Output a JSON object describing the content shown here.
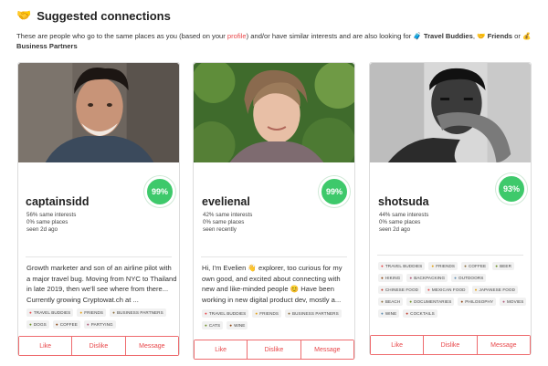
{
  "header": {
    "title": "Suggested connections",
    "desc_pre": "These are people who go to the same places as you (based on your ",
    "desc_link": "profile",
    "desc_mid": ") and/or have similar interests and are also looking for ",
    "desc_travel": "Travel Buddies",
    "desc_comma": ", ",
    "desc_friends": "Friends",
    "desc_or": " or ",
    "desc_business": "Business Partners"
  },
  "buttons": {
    "like": "Like",
    "dislike": "Dislike",
    "message": "Message"
  },
  "cards": [
    {
      "name": "captainsidd",
      "match": "99%",
      "interests": "56% same interests",
      "places": "0% same places",
      "seen": "seen 2d ago",
      "bio_1": "Growth marketer and son of an airline pilot with",
      "bio_2": "a major travel bug. Moving from NYC to Thailand",
      "bio_3": "in late 2019, then we'll see where from there...",
      "bio_4": "Currently growing Cryptowat.ch at ...",
      "tags": [
        "TRAVEL BUDDIES",
        "FRIENDS",
        "BUSINESS PARTNERS",
        "DOGS",
        "COFFEE",
        "PARTYING"
      ]
    },
    {
      "name": "evelienal",
      "match": "99%",
      "interests": "42% same interests",
      "places": "0% same places",
      "seen": "seen recently",
      "bio_1": "Hi, I'm Evelien 👋  explorer, too curious for my",
      "bio_2": "own good, and excited about connecting with",
      "bio_3": "new and like-minded people 😊  Have been",
      "bio_4": "working in new digital product dev, mostly a...",
      "tags": [
        "TRAVEL BUDDIES",
        "FRIENDS",
        "BUSINESS PARTNERS",
        "CATS",
        "WINE"
      ]
    },
    {
      "name": "shotsuda",
      "match": "93%",
      "interests": "44% same interests",
      "places": "0% same places",
      "seen": "seen 2d ago",
      "tags": [
        "TRAVEL BUDDIES",
        "FRIENDS",
        "COFFEE",
        "BEER",
        "HIKING",
        "BACKPACKING",
        "OUTDOORS",
        "CHINESE FOOD",
        "MEXICAN FOOD",
        "JAPANESE FOOD",
        "BEACH",
        "DOCUMENTARIES",
        "PHILOSOPHY",
        "MOVIES",
        "WINE",
        "COCKTAILS"
      ]
    }
  ],
  "tag_icons": {
    "TRAVEL BUDDIES": "●",
    "FRIENDS": "●",
    "BUSINESS PARTNERS": "●",
    "DOGS": "●",
    "COFFEE": "●",
    "PARTYING": "●",
    "CATS": "●",
    "WINE": "●",
    "BEER": "●",
    "HIKING": "●",
    "BACKPACKING": "●",
    "OUTDOORS": "●",
    "CHINESE FOOD": "●",
    "MEXICAN FOOD": "●",
    "JAPANESE FOOD": "●",
    "BEACH": "●",
    "DOCUMENTARIES": "●",
    "PHILOSOPHY": "●",
    "MOVIES": "●",
    "COCKTAILS": "●"
  },
  "colors": {
    "accent": "#e8474a",
    "match": "#3ec96b"
  }
}
